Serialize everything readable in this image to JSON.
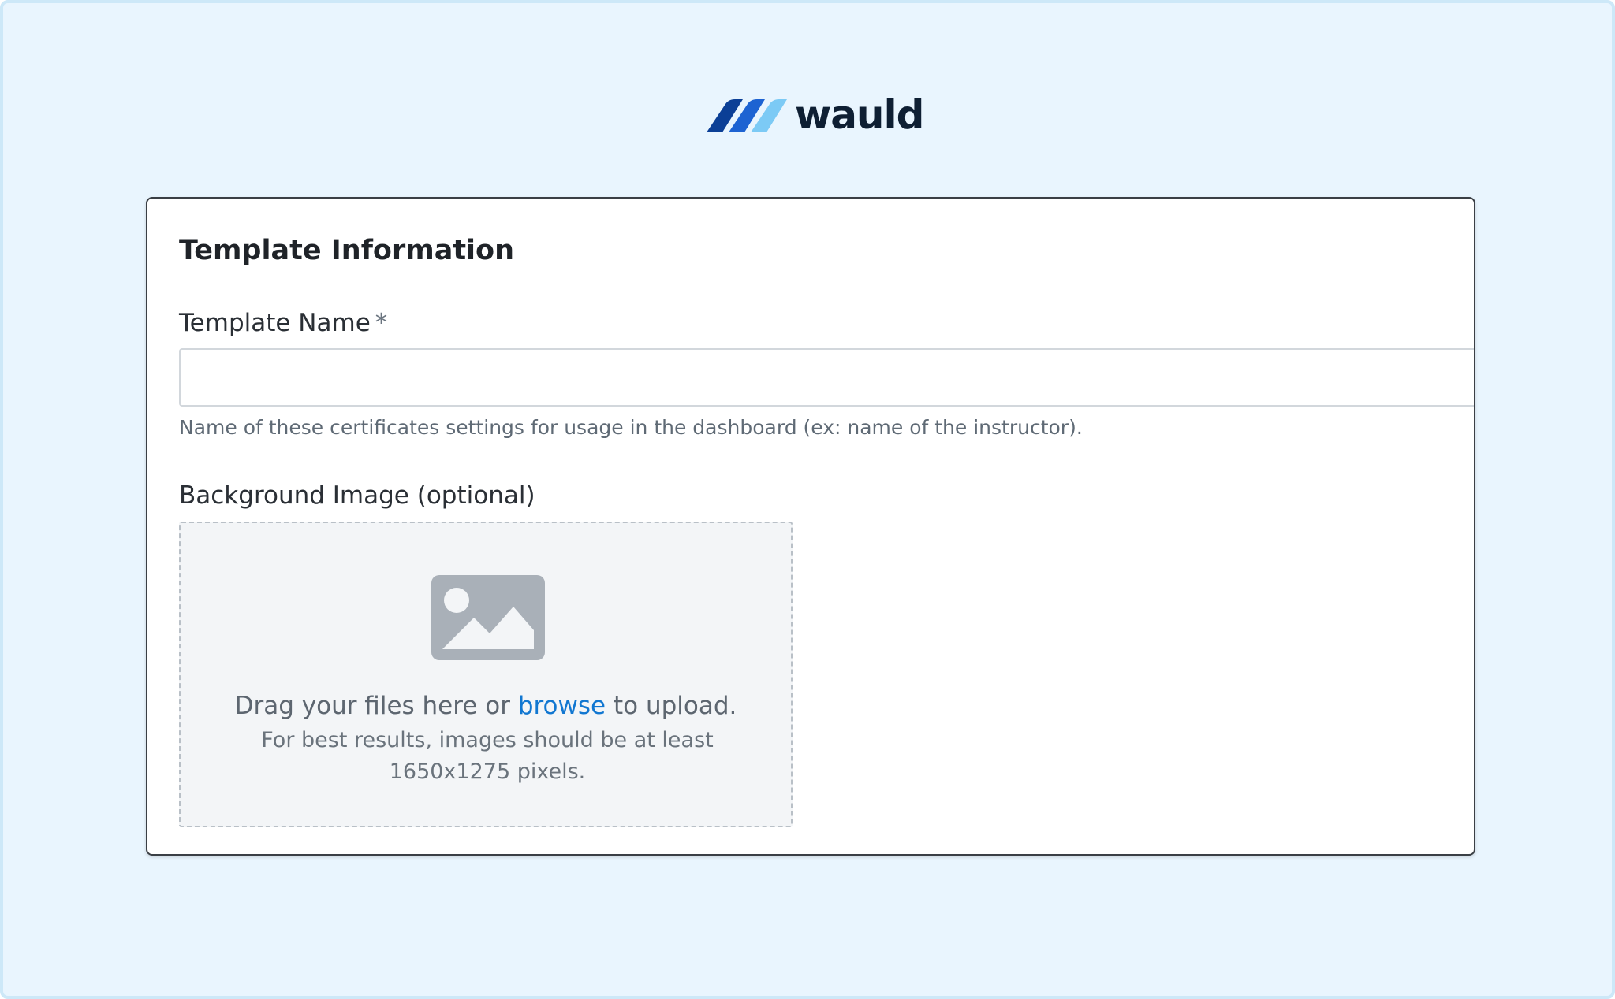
{
  "brand": {
    "name": "wauld",
    "colors": {
      "mark_dark": "#0b3f96",
      "mark_mid": "#1d63d2",
      "mark_light": "#7ccaf5",
      "text": "#0e1f33"
    }
  },
  "form": {
    "section_title": "Template Information",
    "template_name": {
      "label": "Template Name",
      "required_mark": "*",
      "value": "",
      "placeholder": "",
      "hint": "Name of these certificates settings for usage in the dashboard (ex: name of the instructor)."
    },
    "background_image": {
      "label": "Background Image (optional)",
      "icon": "image-icon",
      "drop_prefix": "Drag your files here or ",
      "browse_label": "browse",
      "drop_suffix": " to upload.",
      "recommendation": "For best results, images should be at least 1650x1275 pixels."
    }
  },
  "colors": {
    "page_bg": "#e9f5fe",
    "card_bg": "#ffffff",
    "link": "#1177d1",
    "dropzone_bg": "#f3f5f7"
  }
}
